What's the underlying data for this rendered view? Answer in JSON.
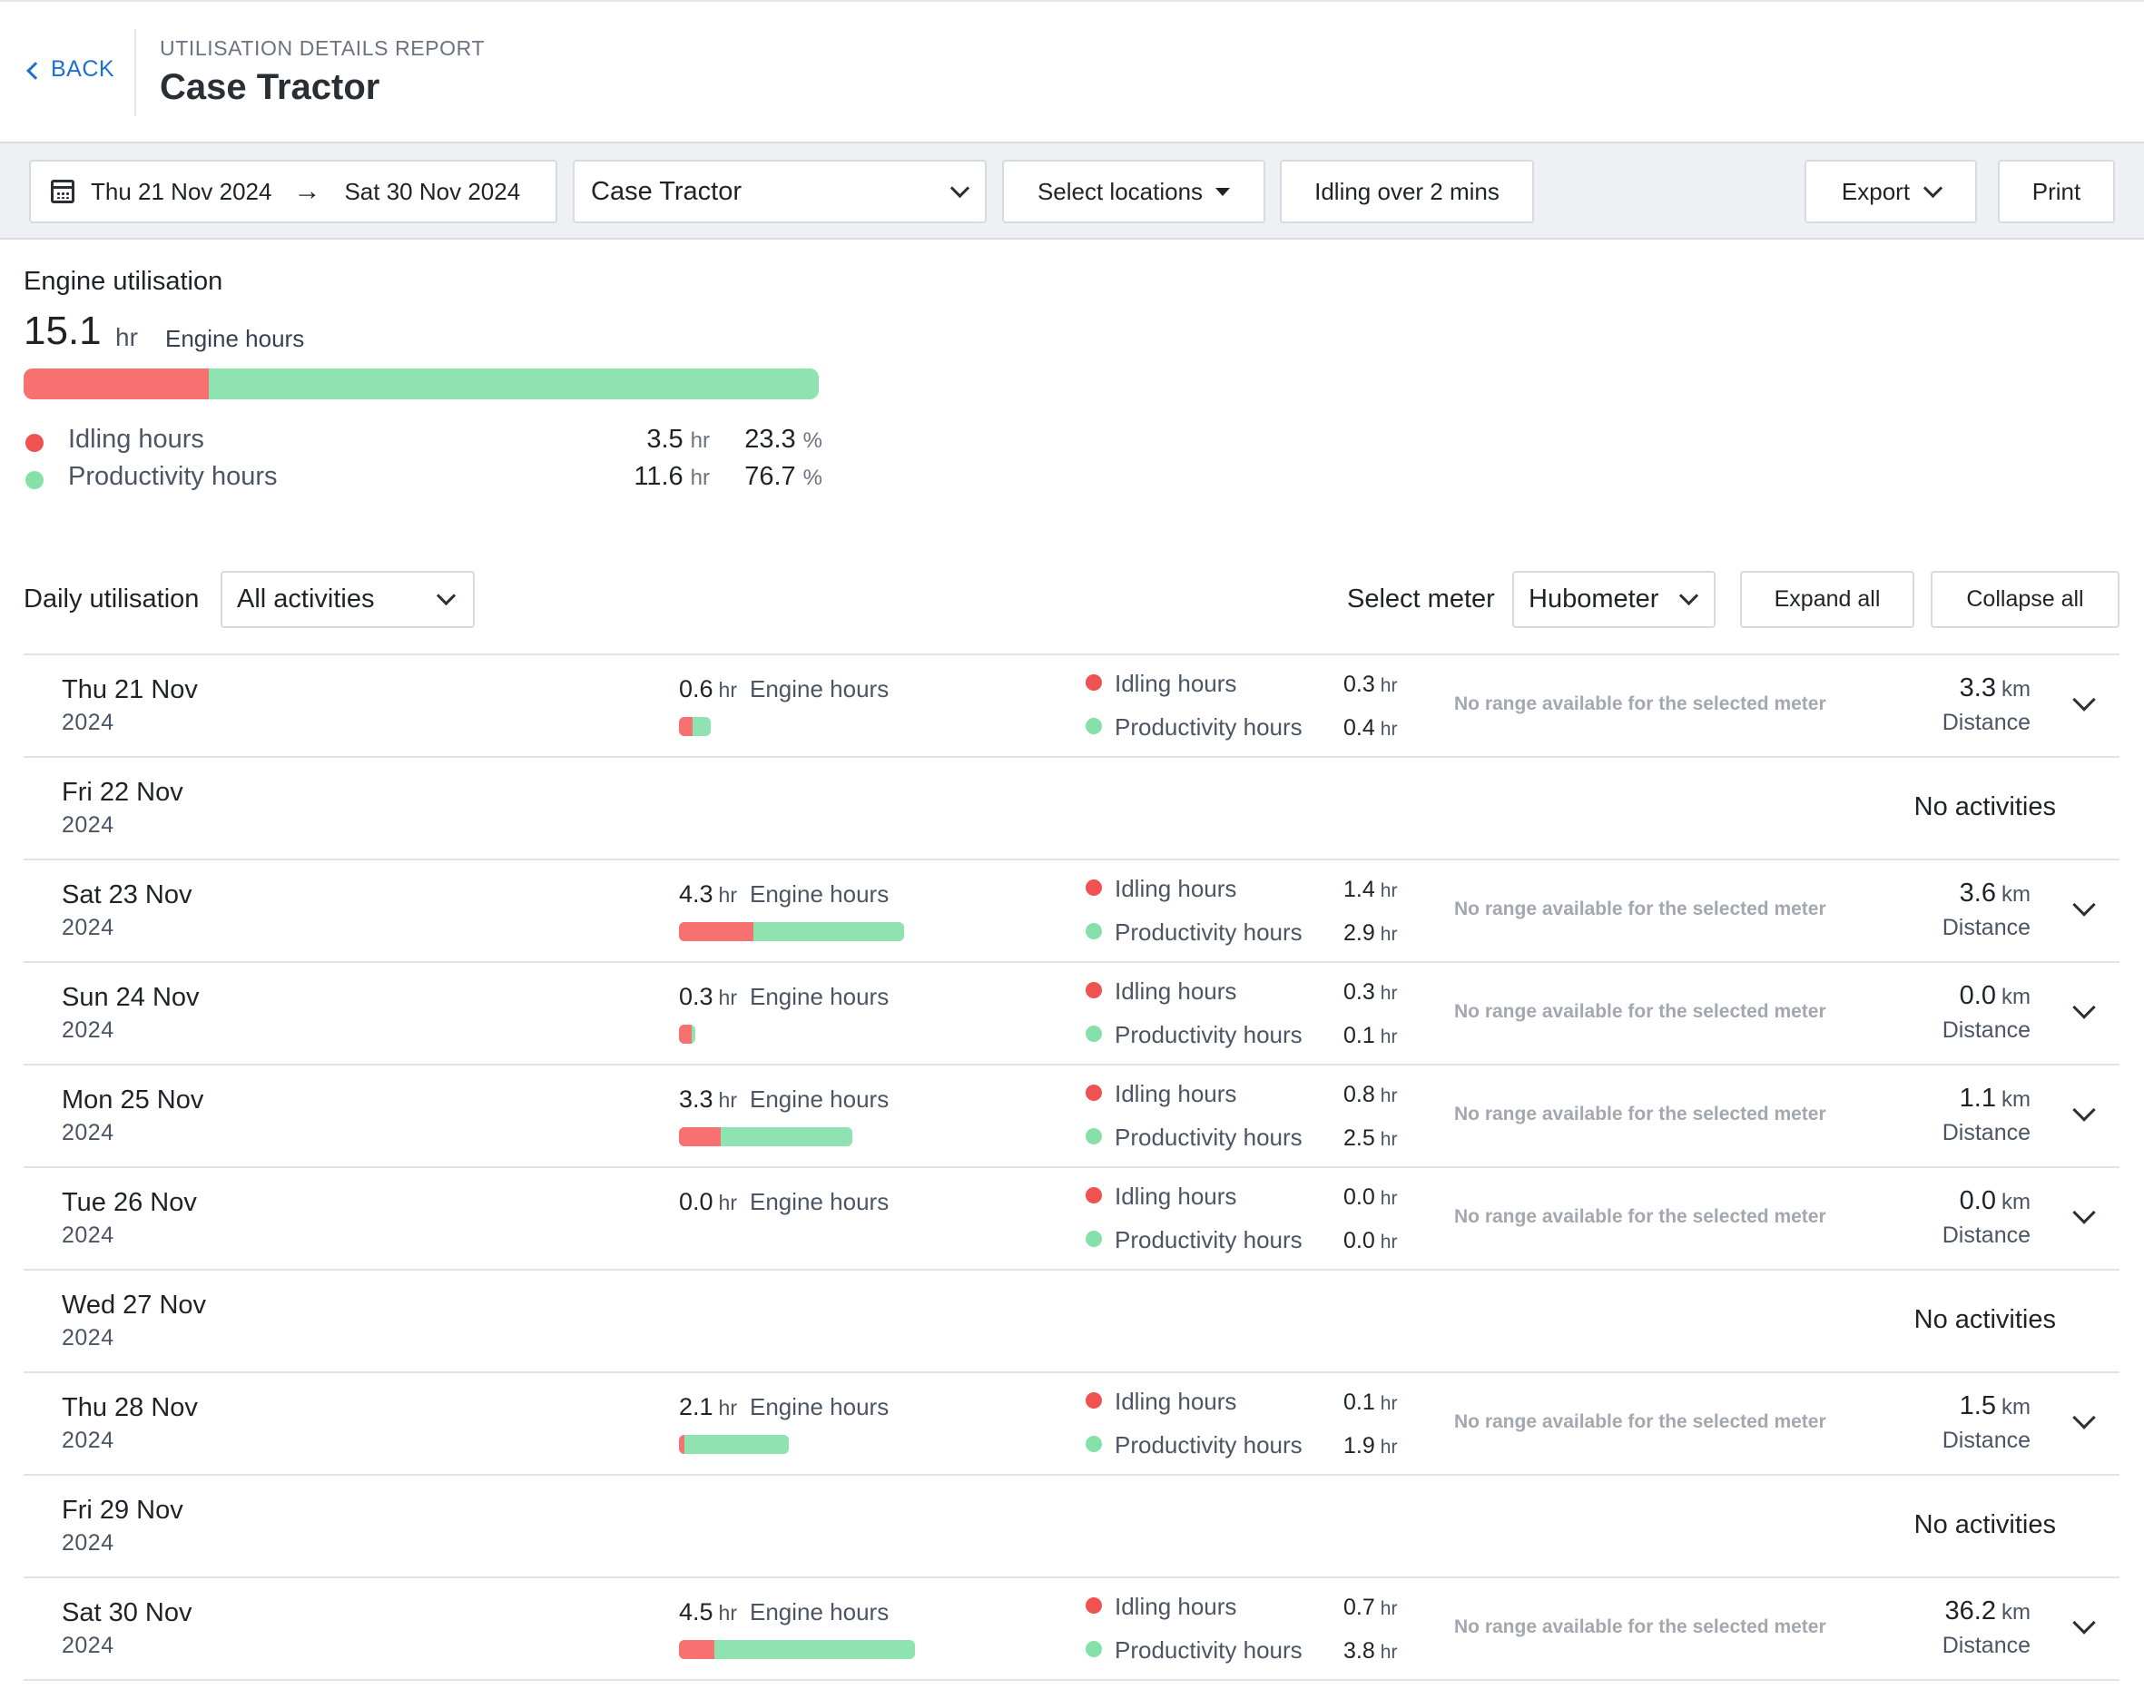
{
  "header": {
    "back_label": "BACK",
    "report_label": "UTILISATION DETAILS REPORT",
    "title": "Case Tractor"
  },
  "toolbar": {
    "date_from": "Thu 21 Nov 2024",
    "date_to": "Sat 30 Nov 2024",
    "asset": "Case Tractor",
    "locations": "Select locations",
    "idling": "Idling over 2 mins",
    "export": "Export",
    "print": "Print"
  },
  "summary": {
    "title": "Engine utilisation",
    "total": "15.1",
    "unit": "hr",
    "total_label": "Engine hours",
    "idle_fraction": 0.233,
    "idling": {
      "label": "Idling hours",
      "hours": "3.5",
      "hours_unit": "hr",
      "pct": "23.3",
      "pct_unit": "%"
    },
    "productivity": {
      "label": "Productivity hours",
      "hours": "11.6",
      "hours_unit": "hr",
      "pct": "76.7",
      "pct_unit": "%"
    }
  },
  "daily": {
    "title": "Daily utilisation",
    "activity_filter": "All activities",
    "meter_label": "Select meter",
    "meter": "Hubometer",
    "expand_all": "Expand all",
    "collapse_all": "Collapse all",
    "labels": {
      "engine_hours": "Engine hours",
      "idling_hours": "Idling hours",
      "productivity_hours": "Productivity hours",
      "no_range": "No range available for the selected meter",
      "distance": "Distance",
      "no_activities": "No activities",
      "hr": "hr",
      "km": "km"
    },
    "rows": [
      {
        "day": "Thu 21 Nov",
        "year": "2024",
        "engine": "0.6",
        "idle": "0.3",
        "prod": "0.4",
        "dist": "3.3",
        "idle_frac": 0.43
      },
      {
        "day": "Fri 22 Nov",
        "year": "2024",
        "no_activities": true
      },
      {
        "day": "Sat 23 Nov",
        "year": "2024",
        "engine": "4.3",
        "idle": "1.4",
        "prod": "2.9",
        "dist": "3.6",
        "idle_frac": 0.33
      },
      {
        "day": "Sun 24 Nov",
        "year": "2024",
        "engine": "0.3",
        "idle": "0.3",
        "prod": "0.1",
        "dist": "0.0",
        "idle_frac": 0.75
      },
      {
        "day": "Mon 25 Nov",
        "year": "2024",
        "engine": "3.3",
        "idle": "0.8",
        "prod": "2.5",
        "dist": "1.1",
        "idle_frac": 0.24
      },
      {
        "day": "Tue 26 Nov",
        "year": "2024",
        "engine": "0.0",
        "idle": "0.0",
        "prod": "0.0",
        "dist": "0.0",
        "idle_frac": 0
      },
      {
        "day": "Wed 27 Nov",
        "year": "2024",
        "no_activities": true
      },
      {
        "day": "Thu 28 Nov",
        "year": "2024",
        "engine": "2.1",
        "idle": "0.1",
        "prod": "1.9",
        "dist": "1.5",
        "idle_frac": 0.05
      },
      {
        "day": "Fri 29 Nov",
        "year": "2024",
        "no_activities": true
      },
      {
        "day": "Sat 30 Nov",
        "year": "2024",
        "engine": "4.5",
        "idle": "0.7",
        "prod": "3.8",
        "dist": "36.2",
        "idle_frac": 0.15
      }
    ]
  },
  "colors": {
    "idle": "#f87171",
    "productivity": "#8fe3b0",
    "accent": "#1f6fd1"
  }
}
